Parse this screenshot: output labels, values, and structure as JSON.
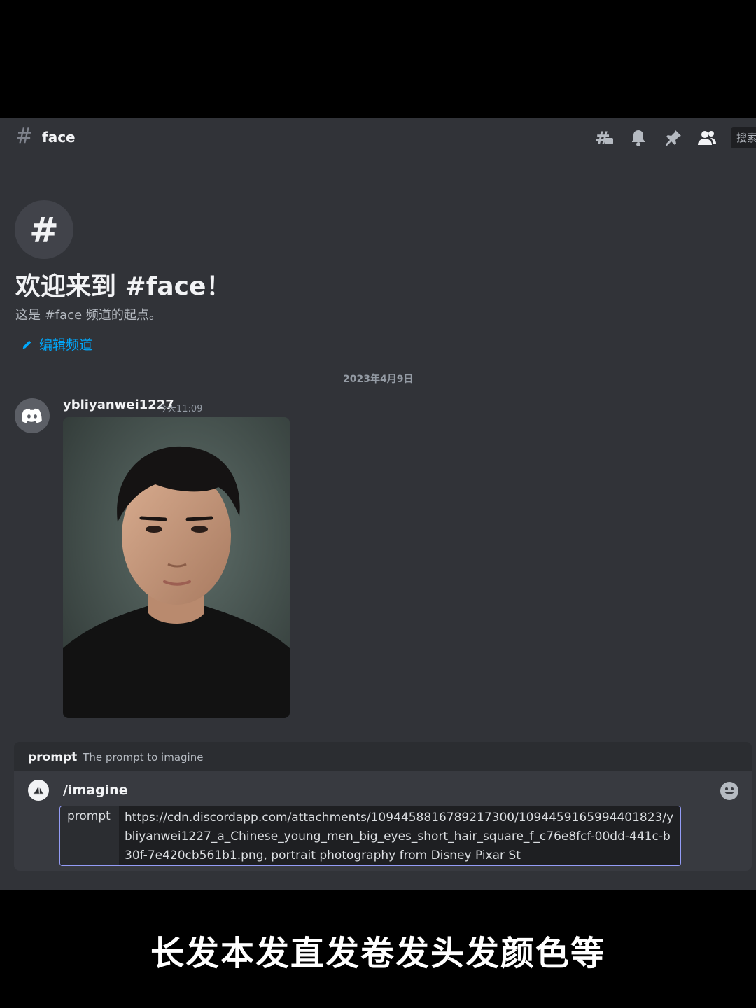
{
  "channel": {
    "name": "face"
  },
  "header": {
    "search_placeholder": "搜索"
  },
  "welcome": {
    "title": "欢迎来到 #face！",
    "subtitle": "这是 #face 频道的起点。",
    "edit_label": "编辑频道"
  },
  "date_divider": "2023年4月9日",
  "message": {
    "username": "ybliyanwei1227",
    "timestamp": "今天11:09"
  },
  "command": {
    "option_name": "prompt",
    "option_description": "The prompt to imagine",
    "name": "/imagine",
    "param_name": "prompt",
    "param_value": "https://cdn.discordapp.com/attachments/1094458816789217300/1094459165994401823/ybliyanwei1227_a_Chinese_young_men_big_eyes_short_hair_square_f_c76e8fcf-00dd-441c-b30f-7e420cb561b1.png, portrait photography from Disney Pixar St"
  },
  "caption": "长发本发直发卷发头发颜色等",
  "colors": {
    "link": "#00a8fc",
    "focus_border": "#949cf7",
    "background": "#313338"
  }
}
